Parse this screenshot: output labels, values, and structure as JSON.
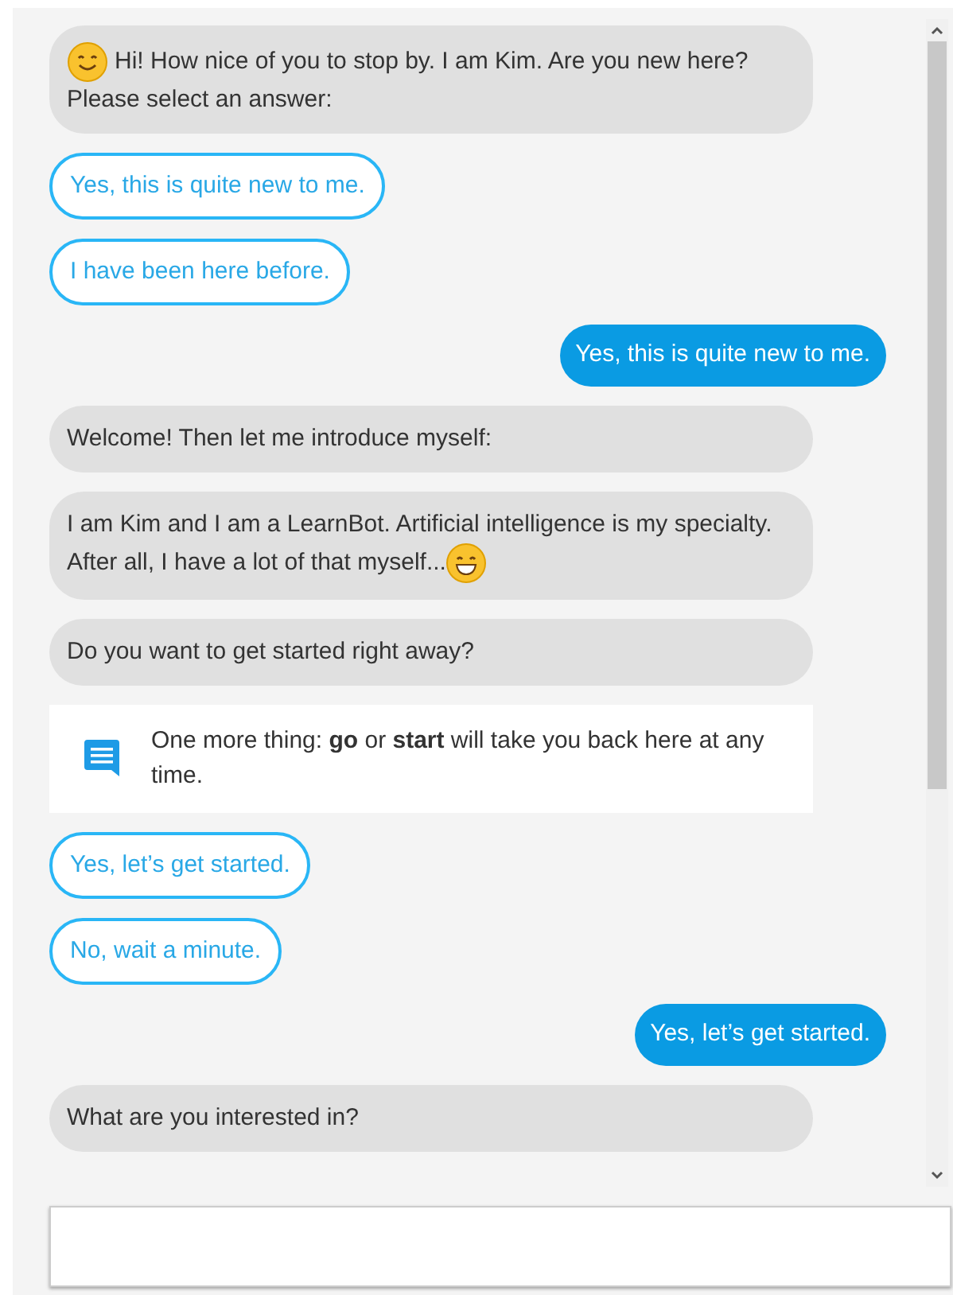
{
  "messages": [
    {
      "kind": "bot_smile_first",
      "text": "Hi! How nice of you to stop by. I am Kim. Are you new here? Please select an answer:"
    },
    {
      "kind": "option",
      "text": "Yes, this is quite new to me."
    },
    {
      "kind": "option",
      "text": "I have been here before."
    },
    {
      "kind": "user",
      "text": "Yes, this is quite new to me."
    },
    {
      "kind": "bot",
      "text": "Welcome! Then let me introduce myself:"
    },
    {
      "kind": "bot_grin_last",
      "text": "I am Kim and I am a LearnBot. Artificial intelligence is my specialty. After all, I have a lot of that myself..."
    },
    {
      "kind": "bot",
      "text": "Do you want to get started right away?"
    },
    {
      "kind": "note",
      "text": "One more thing: **go** or **start** will take you back here at any time."
    },
    {
      "kind": "option",
      "text": "Yes, let’s get started."
    },
    {
      "kind": "option",
      "text": "No, wait a minute."
    },
    {
      "kind": "user",
      "text": "Yes, let’s get started."
    },
    {
      "kind": "bot",
      "text": "What are you interested in?"
    }
  ]
}
